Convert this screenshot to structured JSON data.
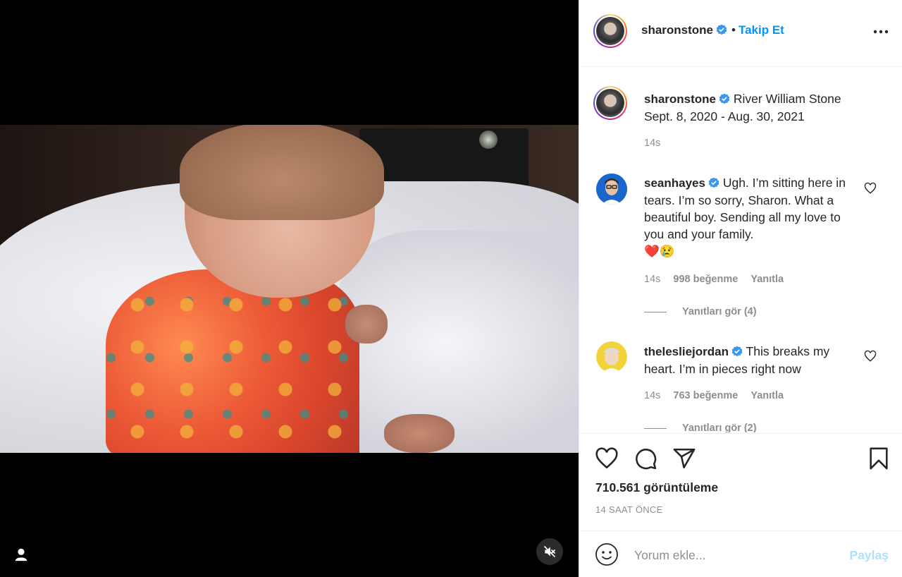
{
  "post": {
    "username": "sharonstone",
    "follow_label": "Takip Et",
    "separator": "•"
  },
  "caption": {
    "username": "sharonstone",
    "text_line1": "River William Stone",
    "text_line2": "Sept. 8, 2020 - Aug. 30, 2021",
    "time": "14s"
  },
  "comments": [
    {
      "username": "seanhayes",
      "text": "Ugh. I’m sitting here in tears. I’m so sorry, Sharon. What a beautiful boy. Sending all my love to you and your family.",
      "emoji": "❤️😢",
      "time": "14s",
      "likes": "998 beğenme",
      "reply_label": "Yanıtla",
      "view_replies": "Yanıtları gör (4)"
    },
    {
      "username": "thelesliejordan",
      "text": "This breaks my heart. I’m in pieces right now",
      "time": "14s",
      "likes": "763 beğenme",
      "reply_label": "Yanıtla",
      "view_replies": "Yanıtları gör (2)"
    }
  ],
  "stats": {
    "views": "710.561 görüntüleme",
    "time_ago": "14 SAAT ÖNCE"
  },
  "composer": {
    "placeholder": "Yorum ekle...",
    "post_label": "Paylaş"
  },
  "icons": {
    "verified": "verified-badge-icon",
    "like": "heart-icon",
    "comment": "comment-icon",
    "share": "share-icon",
    "save": "bookmark-icon",
    "more": "more-options-icon",
    "mute": "muted-speaker-icon",
    "tagged": "user-tag-icon",
    "emoji": "emoji-icon"
  },
  "colors": {
    "accent": "#0095f6",
    "verified": "#3897f0",
    "muted_text": "#8e8e8e",
    "post_disabled": "#b2dffc"
  }
}
